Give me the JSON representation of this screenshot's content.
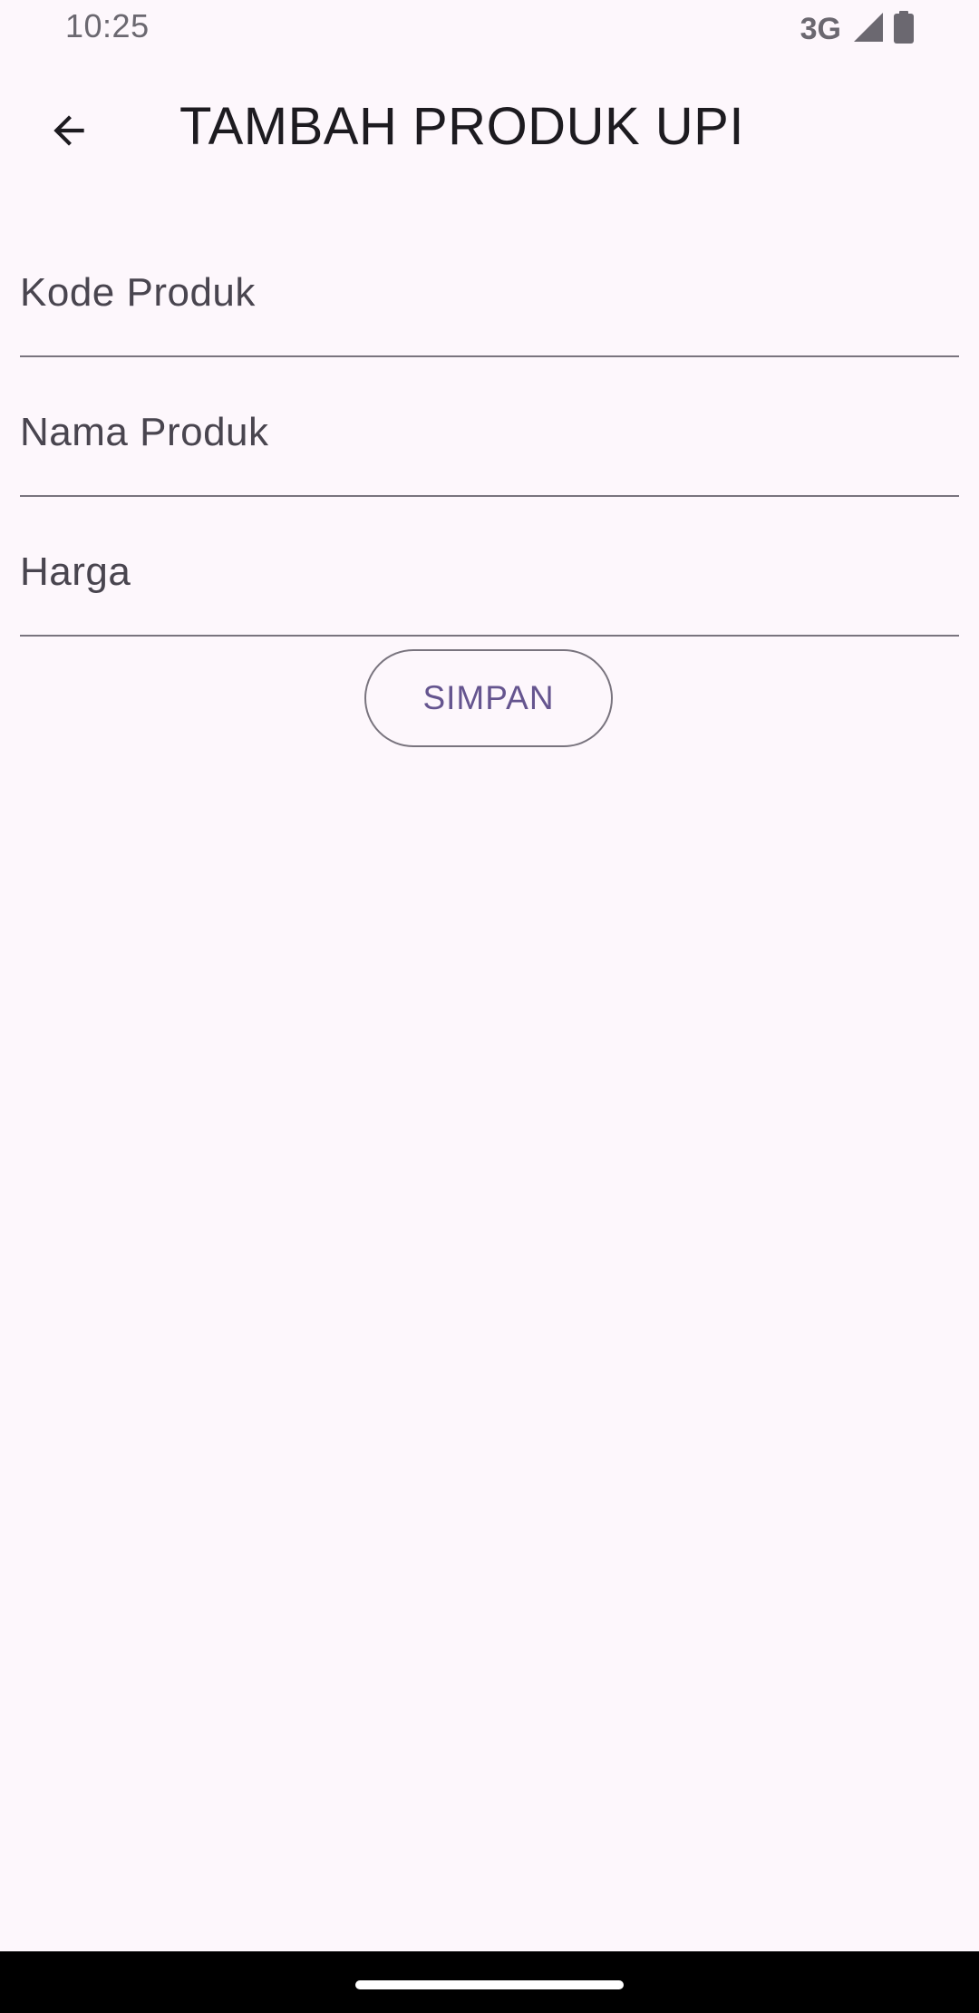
{
  "status_bar": {
    "time": "10:25",
    "network": "3G",
    "icons": [
      "signal-icon",
      "battery-icon"
    ]
  },
  "app_bar": {
    "back_icon": "arrow-left-icon",
    "title": "TAMBAH PRODUK UPI"
  },
  "form": {
    "fields": [
      {
        "placeholder": "Kode Produk",
        "value": ""
      },
      {
        "placeholder": "Nama Produk",
        "value": ""
      },
      {
        "placeholder": "Harga",
        "value": ""
      }
    ],
    "submit_label": "SIMPAN"
  },
  "colors": {
    "background": "#FDF7FC",
    "primary": "#65558F",
    "outline": "#79747E",
    "on_surface": "#1D1B20"
  }
}
